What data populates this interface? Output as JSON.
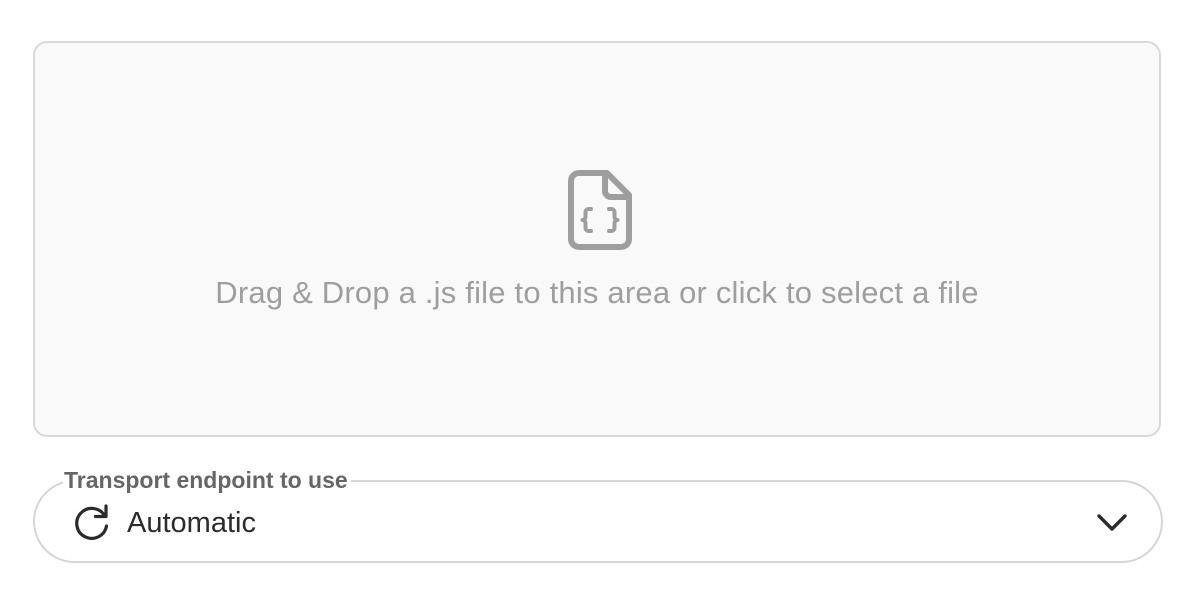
{
  "dropzone": {
    "icon": "file-code-icon",
    "text": "Drag & Drop a .js file to this area or click to select a file"
  },
  "transport": {
    "label": "Transport endpoint to use",
    "value": "Automatic",
    "lead_icon": "refresh-icon",
    "trail_icon": "chevron-down-icon"
  },
  "colors": {
    "dropzone_bg": "#f9f9f9",
    "dropzone_border": "#d9d9d9",
    "muted_text": "#9e9e9e",
    "label_text": "#666666",
    "value_text": "#2b2b2b"
  }
}
